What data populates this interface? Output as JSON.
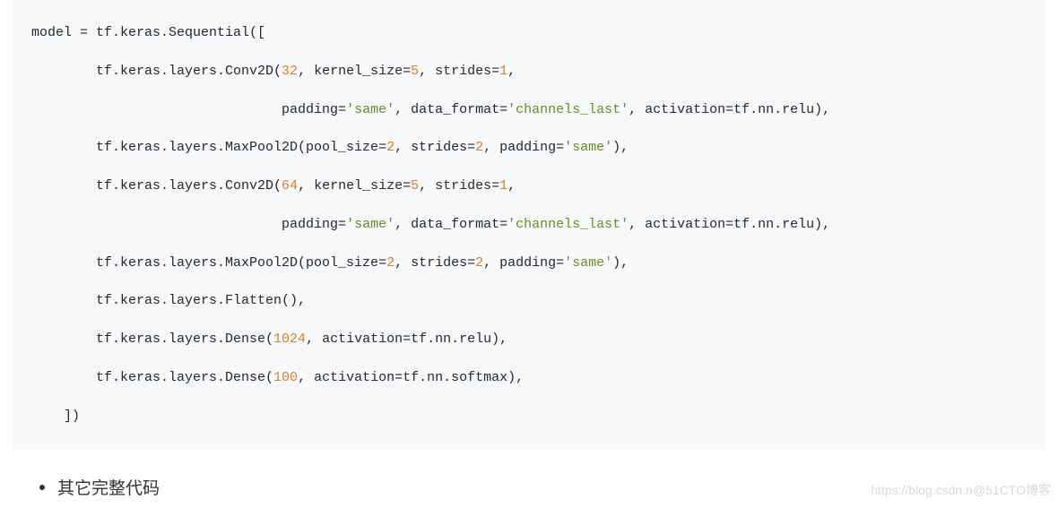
{
  "code": {
    "l1a": "model = tf.keras.Sequential([",
    "l2a": "        tf.keras.layers.Conv2D(",
    "l2n1": "32",
    "l2b": ", kernel_size=",
    "l2n2": "5",
    "l2c": ", strides=",
    "l2n3": "1",
    "l2d": ",",
    "l3a": "                               padding=",
    "l3s1": "'same'",
    "l3b": ", data_format=",
    "l3s2": "'channels_last'",
    "l3c": ", activation=tf.nn.relu),",
    "l4a": "        tf.keras.layers.MaxPool2D(pool_size=",
    "l4n1": "2",
    "l4b": ", strides=",
    "l4n2": "2",
    "l4c": ", padding=",
    "l4s1": "'same'",
    "l4d": "),",
    "l5a": "        tf.keras.layers.Conv2D(",
    "l5n1": "64",
    "l5b": ", kernel_size=",
    "l5n2": "5",
    "l5c": ", strides=",
    "l5n3": "1",
    "l5d": ",",
    "l6a": "                               padding=",
    "l6s1": "'same'",
    "l6b": ", data_format=",
    "l6s2": "'channels_last'",
    "l6c": ", activation=tf.nn.relu),",
    "l7a": "        tf.keras.layers.MaxPool2D(pool_size=",
    "l7n1": "2",
    "l7b": ", strides=",
    "l7n2": "2",
    "l7c": ", padding=",
    "l7s1": "'same'",
    "l7d": "),",
    "l8a": "        tf.keras.layers.Flatten(),",
    "l9a": "        tf.keras.layers.Dense(",
    "l9n1": "1024",
    "l9b": ", activation=tf.nn.relu),",
    "l10a": "        tf.keras.layers.Dense(",
    "l10n1": "100",
    "l10b": ", activation=tf.nn.softmax),",
    "l11a": "    ])"
  },
  "bullet": {
    "text": "其它完整代码"
  },
  "watermark": {
    "left": "https://blog.csdn.n",
    "right": "@51CTO博客"
  }
}
